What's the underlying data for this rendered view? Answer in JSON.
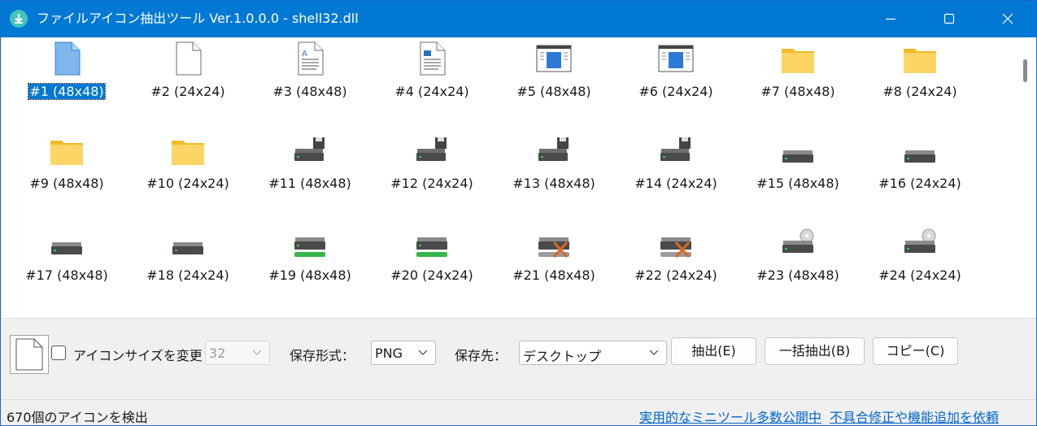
{
  "window": {
    "title": "ファイルアイコン抽出ツール Ver.1.0.0.0 - shell32.dll"
  },
  "icons": [
    {
      "label": "#1 (48x48)",
      "icon": "document-blue-icon"
    },
    {
      "label": "#2 (24x24)",
      "icon": "document-blank-icon"
    },
    {
      "label": "#3 (48x48)",
      "icon": "document-text-icon"
    },
    {
      "label": "#4 (24x24)",
      "icon": "document-image-icon"
    },
    {
      "label": "#5 (48x48)",
      "icon": "application-window-icon"
    },
    {
      "label": "#6 (24x24)",
      "icon": "application-window-icon"
    },
    {
      "label": "#7 (48x48)",
      "icon": "folder-icon"
    },
    {
      "label": "#8 (24x24)",
      "icon": "folder-icon"
    },
    {
      "label": "#9 (48x48)",
      "icon": "folder-icon"
    },
    {
      "label": "#10 (24x24)",
      "icon": "folder-icon"
    },
    {
      "label": "#11 (48x48)",
      "icon": "floppy-drive-icon"
    },
    {
      "label": "#12 (24x24)",
      "icon": "floppy-drive-icon"
    },
    {
      "label": "#13 (48x48)",
      "icon": "floppy-drive-icon"
    },
    {
      "label": "#14 (24x24)",
      "icon": "floppy-drive-icon"
    },
    {
      "label": "#15 (48x48)",
      "icon": "hard-drive-icon"
    },
    {
      "label": "#16 (24x24)",
      "icon": "hard-drive-icon"
    },
    {
      "label": "#17 (48x48)",
      "icon": "hard-drive-icon"
    },
    {
      "label": "#18 (24x24)",
      "icon": "hard-drive-icon"
    },
    {
      "label": "#19 (48x48)",
      "icon": "network-drive-icon"
    },
    {
      "label": "#20 (24x24)",
      "icon": "network-drive-icon"
    },
    {
      "label": "#21 (48x48)",
      "icon": "network-drive-disconnected-icon"
    },
    {
      "label": "#22 (24x24)",
      "icon": "network-drive-disconnected-icon"
    },
    {
      "label": "#23 (48x48)",
      "icon": "cd-drive-icon"
    },
    {
      "label": "#24 (24x24)",
      "icon": "cd-drive-icon"
    }
  ],
  "selected_index": 0,
  "controls": {
    "resize_checkbox_label": "アイコンサイズを変更",
    "size_value": "32",
    "format_label": "保存形式：",
    "format_value": "PNG",
    "dest_label": "保存先：",
    "dest_value": "デスクトップ",
    "extract_button": "抽出(E)",
    "batch_button": "一括抽出(B)",
    "copy_button": "コピー(C)"
  },
  "status": {
    "count_text": "670個のアイコンを検出",
    "link1": "実用的なミニツール多数公開中",
    "link2": "不具合修正や機能追加を依頼"
  },
  "colors": {
    "accent": "#0078d4",
    "folder": "#f8c94a",
    "link": "#0066cc"
  }
}
